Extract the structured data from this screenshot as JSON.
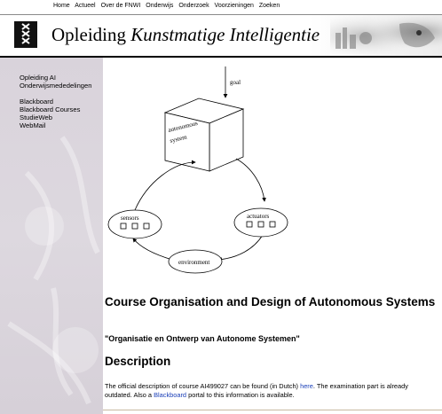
{
  "topnav": {
    "items": [
      "Home",
      "Actueel",
      "Over de FNWI",
      "Onderwijs",
      "Onderzoek",
      "Voorzieningen",
      "Zoeken"
    ]
  },
  "header": {
    "title_plain": "Opleiding",
    "title_italic": "Kunstmatige Intelligentie"
  },
  "sidebar": {
    "group1": [
      "Opleiding AI",
      "Onderwijsmededelingen"
    ],
    "group2": [
      "Blackboard",
      "Blackboard Courses",
      "StudieWeb",
      "WebMail"
    ]
  },
  "diagram": {
    "goal": "goal",
    "box_label_1": "autonomous",
    "box_label_2": "system",
    "sensors": "sensors",
    "actuators": "actuators",
    "environment": "environment"
  },
  "main": {
    "course_title": "Course Organisation and Design of Autonomous Systems",
    "dutch_title": "\"Organisatie en Ontwerp van Autonome Systemen\"",
    "description_heading": "Description",
    "desc_part1": "The official description of course AI499027 can be found (in Dutch) ",
    "desc_link1": "here",
    "desc_part2": ". The examination part is already outdated. Also a ",
    "desc_link2": "Blackboard",
    "desc_part3": " portal to this information is available."
  },
  "colors": {
    "sidebar_bg": "#d9d3db",
    "link": "#1a3fb8"
  }
}
